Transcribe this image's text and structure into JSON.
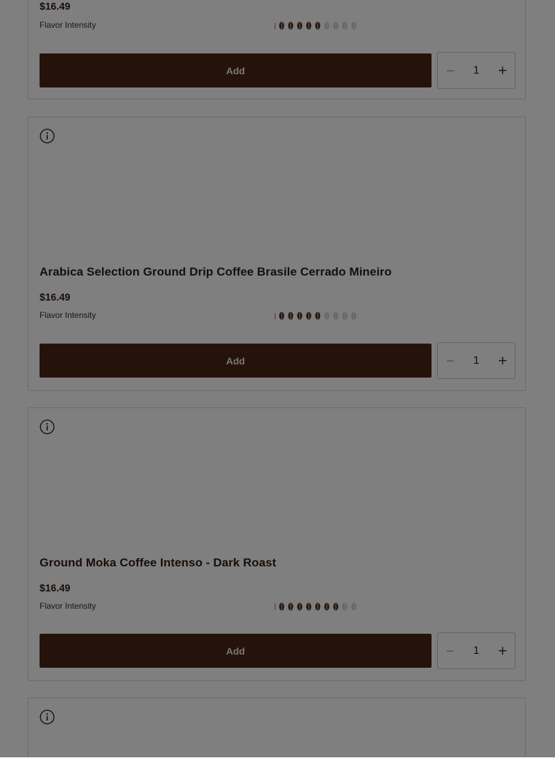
{
  "products": [
    {
      "name": "",
      "price": "$16.49",
      "flavor_label": "Flavor Intensity",
      "intensity": 5,
      "intensity_max": 9,
      "add_label": "Add",
      "quantity": "1"
    },
    {
      "name": "Arabica Selection Ground Drip Coffee Brasile Cerrado Mineiro",
      "price": "$16.49",
      "flavor_label": "Flavor Intensity",
      "intensity": 5,
      "intensity_max": 9,
      "add_label": "Add",
      "quantity": "1"
    },
    {
      "name": "Ground Moka Coffee Intenso - Dark Roast",
      "price": "$16.49",
      "flavor_label": "Flavor Intensity",
      "intensity": 7,
      "intensity_max": 9,
      "add_label": "Add",
      "quantity": "1"
    },
    {
      "name": ""
    }
  ],
  "icons": {
    "info": "info-icon",
    "bean": "coffee-bean-icon",
    "minus": "minus-icon",
    "plus": "plus-icon"
  },
  "colors": {
    "add_button": "#4b2716",
    "bean_filled": "#4b2716",
    "bean_empty": "#d2ccc7",
    "overlay": "rgba(0,0,0,0.5)"
  }
}
